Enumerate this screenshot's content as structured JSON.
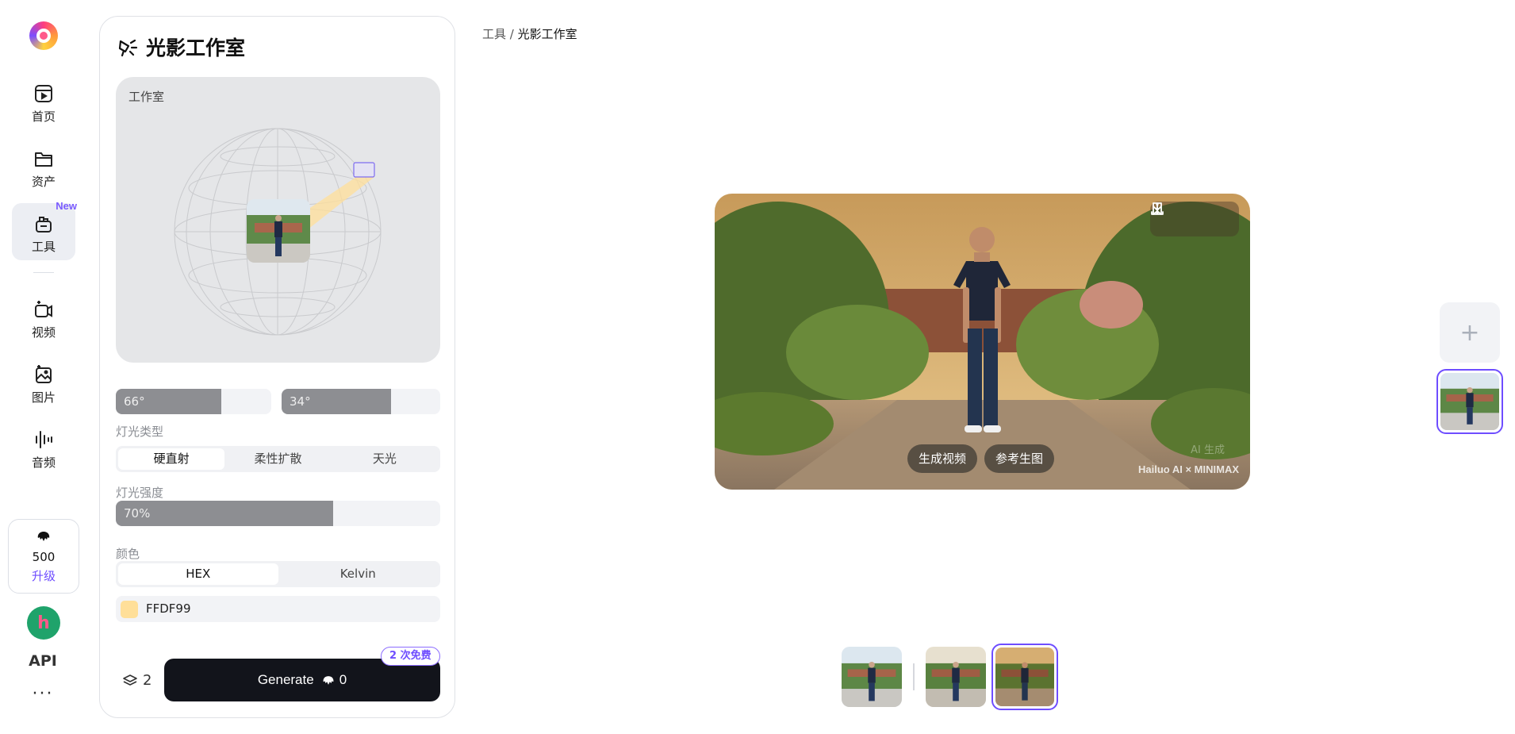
{
  "nav": {
    "items": [
      {
        "label": "首页",
        "icon": "home-icon"
      },
      {
        "label": "资产",
        "icon": "folder-icon"
      },
      {
        "label": "工具",
        "icon": "toolbox-icon",
        "badge": "New",
        "active": true
      },
      {
        "label": "视频",
        "icon": "video-icon"
      },
      {
        "label": "图片",
        "icon": "image-icon"
      },
      {
        "label": "音频",
        "icon": "audio-icon"
      }
    ],
    "credits": "500",
    "upgrade": "升级",
    "api": "API",
    "more": "···"
  },
  "panel": {
    "title": "光影工作室",
    "studio_label": "工作室",
    "angle1": "66°",
    "angle1_fill": 0.68,
    "angle2": "34°",
    "angle2_fill": 0.69,
    "light_type_label": "灯光类型",
    "light_types": [
      "硬直射",
      "柔性扩散",
      "天光"
    ],
    "light_intensity_label": "灯光强度",
    "intensity": "70%",
    "intensity_fill": 0.67,
    "color_label": "颜色",
    "color_modes": [
      "HEX",
      "Kelvin"
    ],
    "hex_value": "FFDF99",
    "hex_color": "#FFDF99",
    "layers_count": "2",
    "generate_label": "Generate",
    "generate_cost": "0",
    "free_badge": "2 次免费"
  },
  "breadcrumb": {
    "parent": "工具",
    "sep": "/",
    "current": "光影工作室"
  },
  "preview": {
    "btn_video": "生成视频",
    "btn_ref": "参考生图",
    "watermark_ai": "AI 生成",
    "watermark_brand": "Hailuo AI × MINIMAX"
  },
  "accent": "#6E4DFF"
}
